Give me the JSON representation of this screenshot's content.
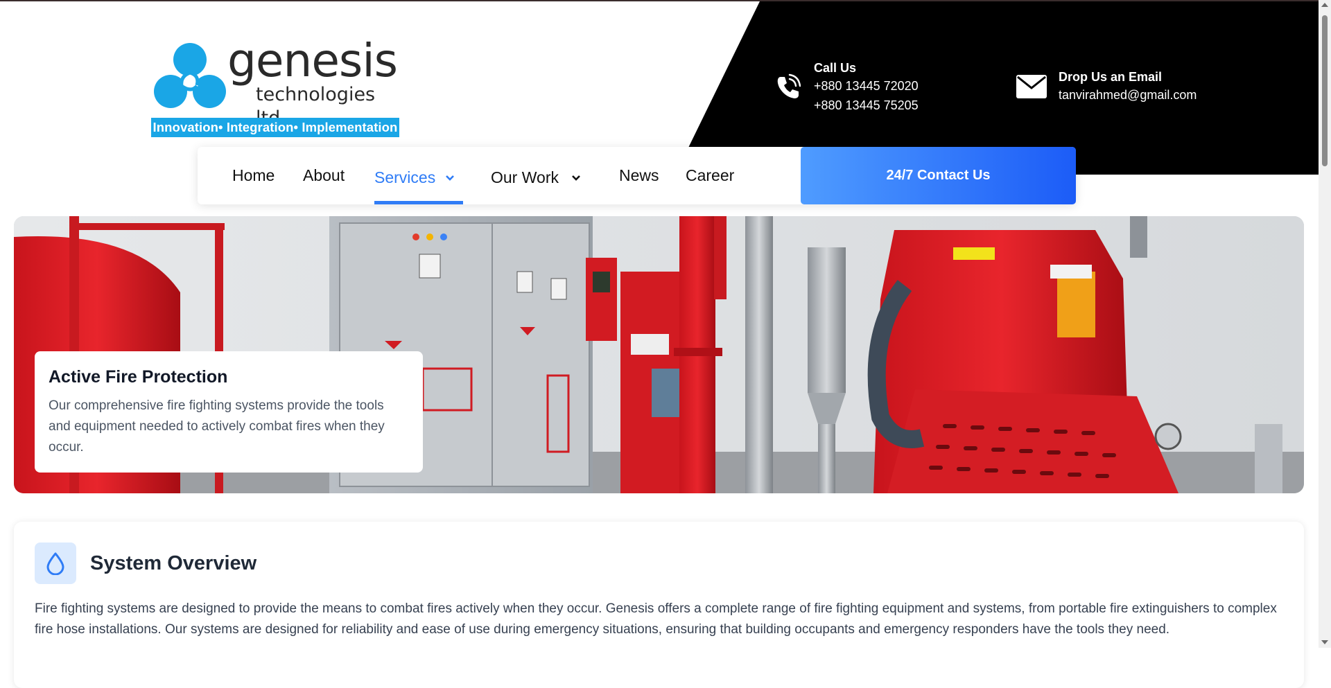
{
  "brand": {
    "wordmark": "genesis",
    "subtitle": "technologies ltd",
    "tagline": "Innovation• Integration• Implementation",
    "logo_colors": {
      "petals": "#1aa6e6",
      "text": "#2a2a2a",
      "tag_bg": "#1aa6e6"
    }
  },
  "contact": {
    "call": {
      "icon": "phone-icon",
      "title": "Call Us",
      "lines": [
        "+880 13445 72020",
        "+880 13445 75205"
      ]
    },
    "email": {
      "icon": "envelope-icon",
      "title": "Drop Us an Email",
      "address": "tanvirahmed@gmail.com"
    }
  },
  "nav": {
    "items": [
      {
        "label": "Home"
      },
      {
        "label": "About"
      },
      {
        "label": "Services",
        "dropdown": true,
        "active": true
      },
      {
        "label": "Our Work",
        "dropdown": true
      },
      {
        "label": "News"
      },
      {
        "label": "Career"
      }
    ],
    "cta_label": "24/7 Contact Us"
  },
  "hero": {
    "title": "Active Fire Protection",
    "text": "Our comprehensive fire fighting systems provide the tools and equipment needed to actively combat fires when they occur."
  },
  "overview": {
    "icon": "water-drop-icon",
    "title": "System Overview",
    "text": "Fire fighting systems are designed to provide the means to combat fires actively when they occur. Genesis offers a complete range of fire fighting equipment and systems, from portable fire extinguishers to complex fire hose installations. Our systems are designed for reliability and ease of use during emergency situations, ensuring that building occupants and emergency responders have the tools they need."
  },
  "colors": {
    "accent": "#2f7cf6",
    "cta_gradient_start": "#4f9cff",
    "cta_gradient_end": "#1c5cf7",
    "header_band": "#000000"
  }
}
